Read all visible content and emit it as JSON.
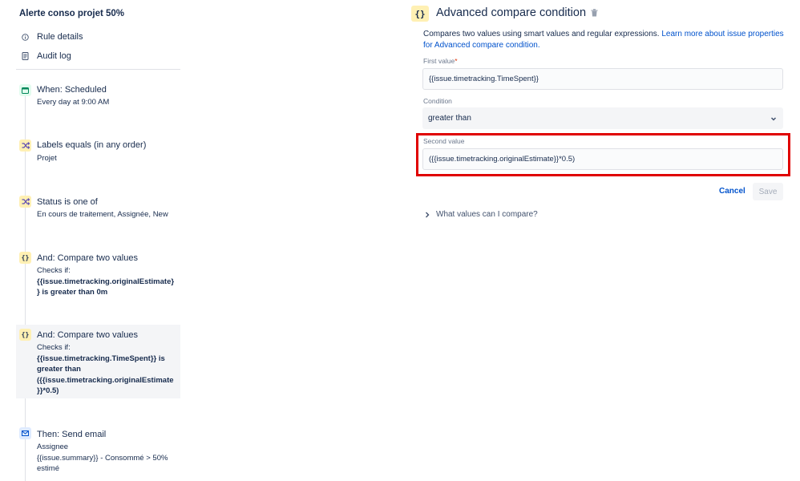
{
  "rule": {
    "title": "Alerte conso projet 50%",
    "nav": [
      {
        "label": "Rule details",
        "icon": "info-icon"
      },
      {
        "label": "Audit log",
        "icon": "audit-log-icon"
      }
    ]
  },
  "steps": [
    {
      "icon": "calendar-icon",
      "title": "When: Scheduled",
      "desc": [
        "Every day at 9:00 AM"
      ]
    },
    {
      "icon": "shuffle-icon",
      "title": "Labels equals (in any order)",
      "desc": [
        "Projet"
      ]
    },
    {
      "icon": "shuffle-icon",
      "title": "Status is one of",
      "desc": [
        "En cours de traitement, Assignée, New"
      ]
    },
    {
      "icon": "braces-icon",
      "title": "And: Compare two values",
      "desc_intro": "Checks if:",
      "desc_bold": [
        "{{issue.timetracking.originalEstimate}",
        "} is greater than 0m"
      ]
    },
    {
      "icon": "braces-icon",
      "title": "And: Compare two values",
      "desc_intro": "Checks if:",
      "desc_bold": [
        "{{issue.timetracking.TimeSpent}} is",
        "greater than",
        "({{issue.timetracking.originalEstimate",
        "}}*0.5)"
      ]
    },
    {
      "icon": "email-icon",
      "title": "Then: Send email",
      "desc": [
        "Assignee",
        "{{issue.summary}} - Consommé > 50%",
        "estimé"
      ]
    }
  ],
  "editor": {
    "icon_glyph": "{}",
    "title": "Advanced compare condition",
    "description": "Compares two values using smart values and regular expressions.",
    "link_text": "Learn more about issue properties",
    "link_text_2": "for Advanced compare condition.",
    "first_value_label": "First value",
    "required_mark": "*",
    "first_value": "{{issue.timetracking.TimeSpent}}",
    "condition_label": "Condition",
    "condition_value": "greater than",
    "second_value_label": "Second value",
    "second_value": "({{issue.timetracking.originalEstimate}}*0.5)",
    "cancel_label": "Cancel",
    "save_label": "Save",
    "expander_label": "What values can I compare?"
  },
  "colors": {
    "highlight_border": "#e00000",
    "link": "#0052cc"
  }
}
